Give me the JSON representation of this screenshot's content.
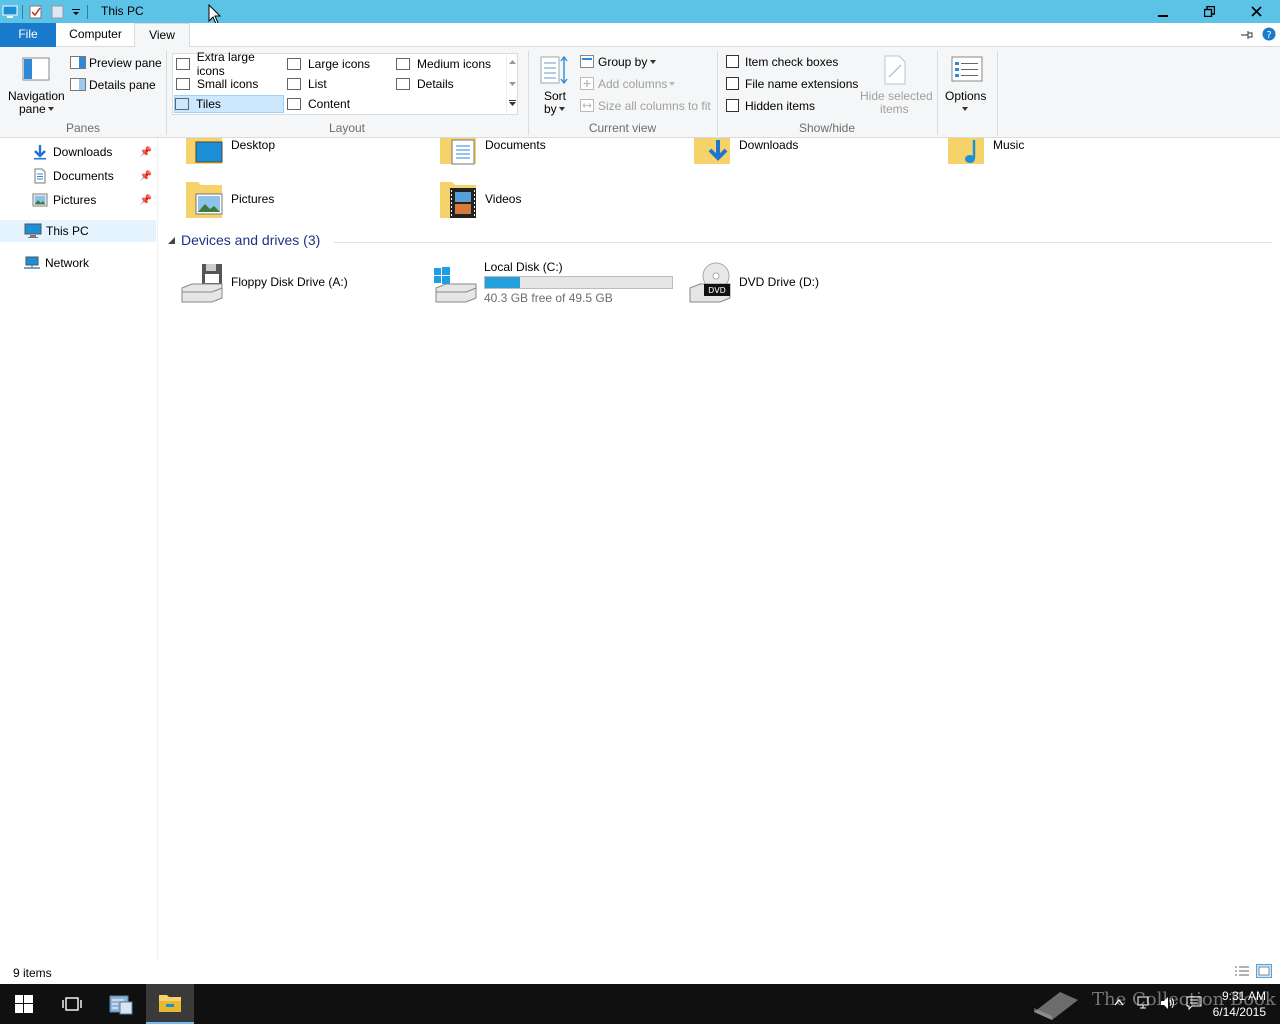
{
  "window": {
    "title": "This PC"
  },
  "tabs": [
    {
      "label": "File"
    },
    {
      "label": "Computer"
    },
    {
      "label": "View"
    }
  ],
  "ribbon": {
    "panes": {
      "label": "Panes",
      "navigation_pane": "Navigation",
      "navigation_pane_2": "pane",
      "preview_pane": "Preview pane",
      "details_pane": "Details pane"
    },
    "layout": {
      "label": "Layout",
      "items": [
        "Extra large icons",
        "Large icons",
        "Medium icons",
        "Small icons",
        "List",
        "Details",
        "Tiles",
        "Content"
      ],
      "selected": "Tiles"
    },
    "current_view": {
      "label": "Current view",
      "sort_by": "Sort",
      "sort_by_2": "by",
      "group_by": "Group by",
      "add_columns": "Add columns",
      "size_all_columns": "Size all columns to fit"
    },
    "show_hide": {
      "label": "Show/hide",
      "item_check_boxes": "Item check boxes",
      "file_name_extensions": "File name extensions",
      "hidden_items": "Hidden items",
      "hide_selected_items": "Hide selected",
      "hide_selected_items_2": "items"
    },
    "options": {
      "label": "Options"
    }
  },
  "nav": {
    "quick_access": [
      {
        "label": "Downloads",
        "pinned": true
      },
      {
        "label": "Documents",
        "pinned": true
      },
      {
        "label": "Pictures",
        "pinned": true
      }
    ],
    "this_pc": "This PC",
    "network": "Network"
  },
  "folders": [
    {
      "name": "Desktop"
    },
    {
      "name": "Documents"
    },
    {
      "name": "Downloads"
    },
    {
      "name": "Music"
    },
    {
      "name": "Pictures"
    },
    {
      "name": "Videos"
    }
  ],
  "devices": {
    "header": "Devices and drives (3)",
    "items": [
      {
        "name": "Floppy Disk Drive (A:)"
      },
      {
        "name": "Local Disk (C:)",
        "free_text": "40.3 GB free of 49.5 GB",
        "used_fraction": 0.186
      },
      {
        "name": "DVD Drive (D:)"
      }
    ]
  },
  "status": {
    "item_count": "9 items"
  },
  "taskbar": {
    "time": "9:31 AM",
    "date": "6/14/2015",
    "watermark": "The Collection Book"
  },
  "colors": {
    "titlebar": "#5cc3e7",
    "file_tab": "#1979ca",
    "selection": "#cce8ff",
    "disk_fill": "#26a0da",
    "taskbar": "#101010"
  }
}
